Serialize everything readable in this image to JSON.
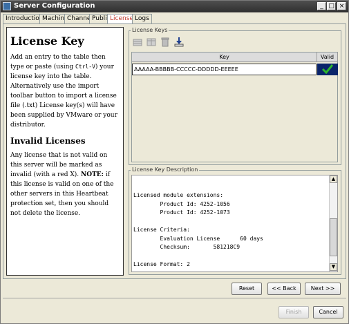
{
  "window": {
    "title": "Server Configuration"
  },
  "tabs": [
    {
      "label": "Introduction"
    },
    {
      "label": "Machine"
    },
    {
      "label": "Channel"
    },
    {
      "label": "Public"
    },
    {
      "label": "License",
      "active": true
    },
    {
      "label": "Logs"
    }
  ],
  "help": {
    "heading": "License Key",
    "p1_a": "Add an entry to the table then type or paste (using ",
    "p1_code": "Ctrl-V",
    "p1_b": ") your license key into the table. Alternatively use the import toolbar button to import a license file (.txt) License key(s) will have been supplied by VMware or your distributor.",
    "subheading": "Invalid Licenses",
    "p2_a": "Any license that is not valid on this server will be marked as invalid (with a red X). ",
    "p2_note": "NOTE:",
    "p2_b": " if this license is valid on one of the other servers in this Heartbeat protection set, then you should not delete the license."
  },
  "license_keys": {
    "group_label": "License Keys",
    "col_key": "Key",
    "col_valid": "Valid",
    "rows": [
      {
        "key": "AAAAA-BBBBB-CCCCC-DDDDD-EEEEE",
        "valid": true
      }
    ]
  },
  "description": {
    "group_label": "License Key Description",
    "text": "Licensed module extensions:\n        Product Id: 4252-1056\n        Product Id: 4252-1073\n\nLicense Criteria:\n        Evaluation License      60 days\n        Checksum:       581218C9\n\nLicense Format: 2"
  },
  "nav": {
    "reset": "Reset",
    "back": "<< Back",
    "next": "Next >>"
  },
  "footer": {
    "finish": "Finish",
    "cancel": "Cancel"
  },
  "colors": {
    "valid_check": "#2db52d",
    "active_tab_text": "#c0392b",
    "selected_cell": "#0a246a"
  }
}
